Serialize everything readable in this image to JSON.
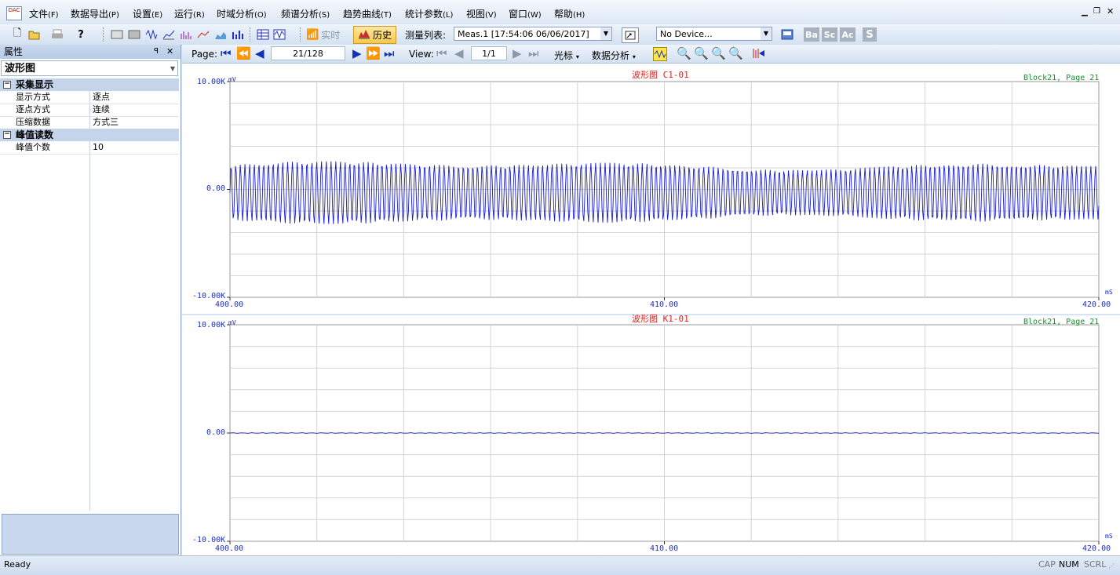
{
  "menu": {
    "items": [
      {
        "label": "文件",
        "acc": "(F)"
      },
      {
        "label": "数据导出",
        "acc": "(P)"
      },
      {
        "label": "设置",
        "acc": "(E)"
      },
      {
        "label": "运行",
        "acc": "(R)"
      },
      {
        "label": "时域分析",
        "acc": "(O)"
      },
      {
        "label": "频谱分析",
        "acc": "(S)"
      },
      {
        "label": "趋势曲线",
        "acc": "(T)"
      },
      {
        "label": "统计参数",
        "acc": "(L)"
      },
      {
        "label": "视图",
        "acc": "(V)"
      },
      {
        "label": "窗口",
        "acc": "(W)"
      },
      {
        "label": "帮助",
        "acc": "(H)"
      }
    ]
  },
  "toolbar": {
    "realtime_label": "实时",
    "history_label": "历史",
    "meas_list_label": "测量列表:",
    "meas_selected": "Meas.1 [17:54:06 06/06/2017]",
    "device_selected": "No Device...",
    "ba_label": "Ba",
    "sc_label": "Sc",
    "ac_label": "Ac",
    "s_label": "S"
  },
  "panel": {
    "title": "属性",
    "pin": "ㅁ",
    "close": "✕",
    "selector": "波形图",
    "categories": [
      {
        "label": "采集显示",
        "rows": [
          {
            "key": "显示方式",
            "value": "逐点"
          },
          {
            "key": "逐点方式",
            "value": "连续"
          },
          {
            "key": "压缩数据",
            "value": "方式三"
          }
        ]
      },
      {
        "label": "峰值读数",
        "rows": [
          {
            "key": "峰值个数",
            "value": "10"
          }
        ]
      }
    ]
  },
  "nav": {
    "page_label": "Page:",
    "page_value": "21/128",
    "view_label": "View:",
    "view_value": "1/1",
    "cursor_label": "光标",
    "analysis_label": "数据分析"
  },
  "charts": [
    {
      "title": "波形图  C1-01",
      "block": "Block21, Page 21",
      "y_unit": "mV",
      "x_unit": "mS",
      "y_top": "10.00K",
      "y_mid": "0.00",
      "y_bottom": "-10.00K",
      "x_left": "400.00",
      "x_mid": "410.00",
      "x_right": "420.00"
    },
    {
      "title": "波形图  K1-01",
      "block": "Block21, Page 21",
      "y_unit": "mV",
      "x_unit": "mS",
      "y_top": "10.00K",
      "y_mid": "0.00",
      "y_bottom": "-10.00K",
      "x_left": "400.00",
      "x_mid": "410.00",
      "x_right": "420.00"
    }
  ],
  "chart_data": [
    {
      "type": "line",
      "title": "波形图  C1-01",
      "xlabel": "mS",
      "ylabel": "mV",
      "xlim": [
        400,
        420
      ],
      "ylim": [
        -10000,
        10000
      ],
      "grid": true,
      "series": [
        {
          "amplitude_mv": 3000,
          "pattern": "oscillating"
        }
      ]
    },
    {
      "type": "line",
      "title": "波形图  K1-01",
      "xlabel": "mS",
      "ylabel": "mV",
      "xlim": [
        400,
        420
      ],
      "ylim": [
        -10000,
        10000
      ],
      "grid": true,
      "series": [
        {
          "amplitude_mv": 30,
          "pattern": "flat"
        }
      ]
    }
  ],
  "status": {
    "text": "Ready",
    "cap": "CAP",
    "num": "NUM",
    "scrl": "SCRL"
  },
  "colors": {
    "trace": "#1a1fc8",
    "title": "#e0201c",
    "block": "#12922a",
    "axis": "#1a2fc2",
    "grid": "#d4d4d4"
  }
}
